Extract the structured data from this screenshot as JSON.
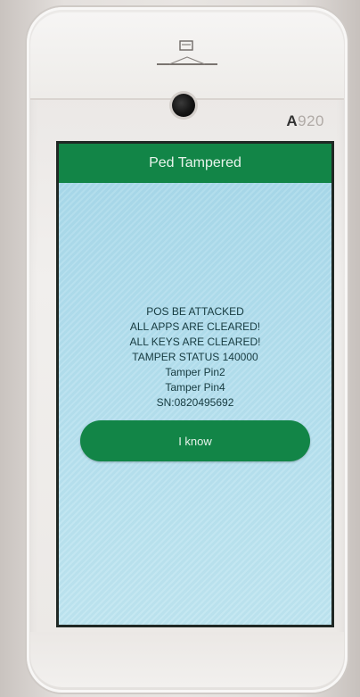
{
  "device": {
    "model_prefix": "A",
    "model_suffix": "920"
  },
  "dialog": {
    "title": "Ped Tampered",
    "lines": [
      "POS BE ATTACKED",
      "ALL APPS ARE CLEARED!",
      "ALL KEYS ARE CLEARED!",
      "TAMPER STATUS 140000",
      "Tamper Pin2",
      "Tamper Pin4",
      "SN:0820495692"
    ],
    "button_label": "I know"
  },
  "colors": {
    "title_bar": "#128547",
    "button": "#128547",
    "screen_background": "#b2deed"
  }
}
